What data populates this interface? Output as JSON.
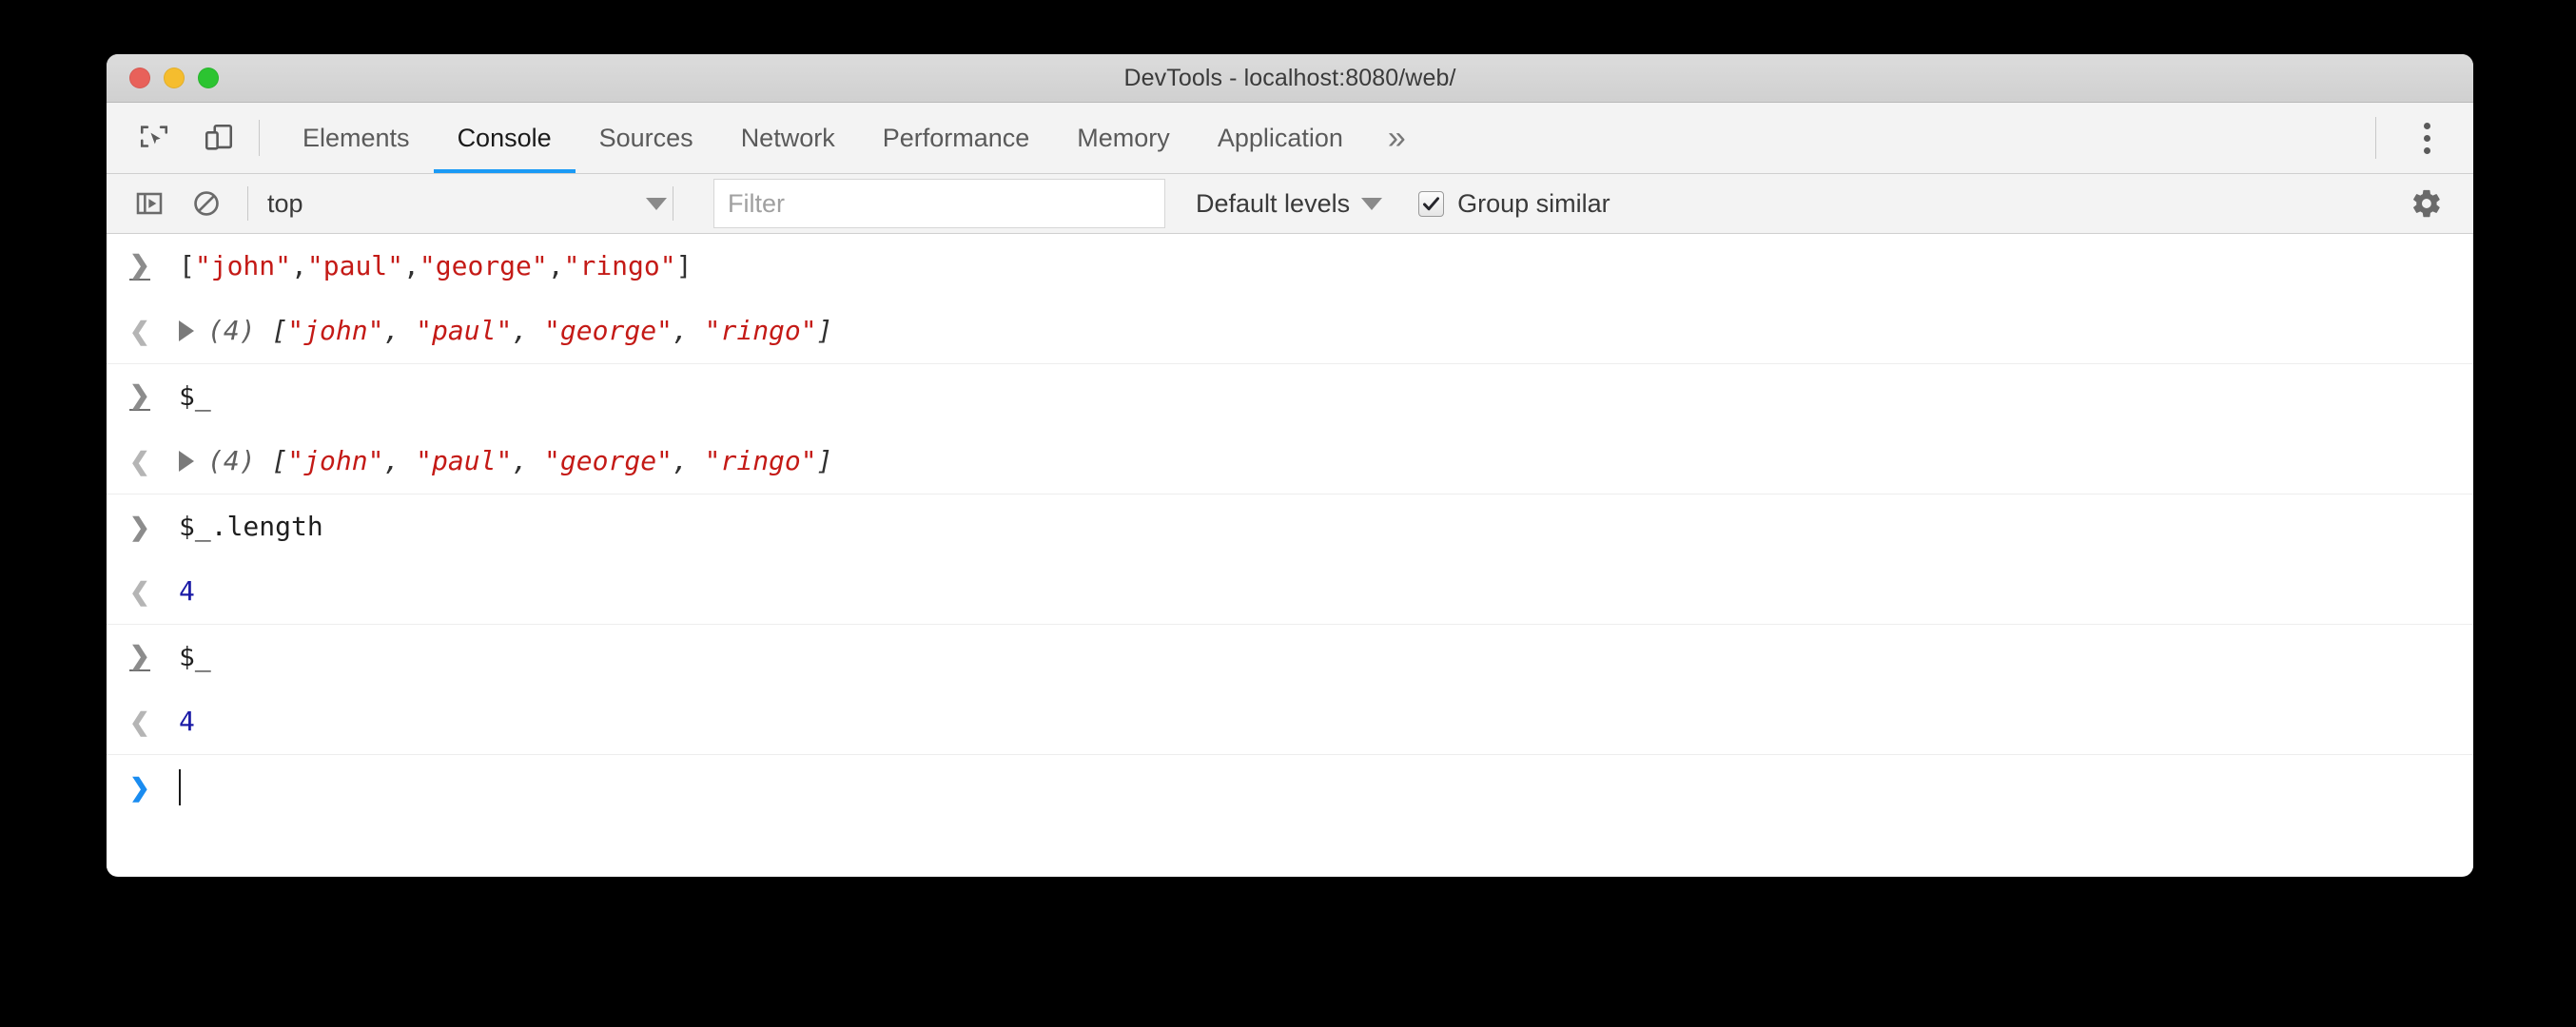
{
  "window": {
    "title": "DevTools - localhost:8080/web/",
    "traffic_lights": [
      {
        "name": "close",
        "color": "#e8615a"
      },
      {
        "name": "minimize",
        "color": "#f5bd2e"
      },
      {
        "name": "zoom",
        "color": "#2cc431"
      }
    ]
  },
  "toolbar": {
    "inspect_icon": "inspect-element-icon",
    "device_icon": "device-toolbar-icon",
    "overflow_label": "»",
    "tabs": [
      {
        "label": "Elements",
        "active": false
      },
      {
        "label": "Console",
        "active": true
      },
      {
        "label": "Sources",
        "active": false
      },
      {
        "label": "Network",
        "active": false
      },
      {
        "label": "Performance",
        "active": false
      },
      {
        "label": "Memory",
        "active": false
      },
      {
        "label": "Application",
        "active": false
      }
    ],
    "menu_icon": "kebab-menu-icon",
    "active_tab_underline_color": "#1a9af5"
  },
  "console_toolbar": {
    "sidebar_toggle_icon": "console-sidebar-toggle-icon",
    "clear_icon": "clear-console-icon",
    "context": "top",
    "context_caret": "▼",
    "filter_placeholder": "Filter",
    "filter_value": "",
    "levels_label": "Default levels",
    "levels_caret": "▼",
    "group_similar_label": "Group similar",
    "group_similar_checked": true,
    "checkmark": "✔",
    "settings_icon": "gear-icon"
  },
  "console": {
    "prompt_in": "❯",
    "prompt_out": "❮",
    "groups": [
      {
        "input": {
          "prompt_style": "underlined",
          "segments": [
            {
              "text": "[",
              "kind": "punct"
            },
            {
              "text": "\"john\"",
              "kind": "str"
            },
            {
              "text": ",",
              "kind": "punct"
            },
            {
              "text": "\"paul\"",
              "kind": "str"
            },
            {
              "text": ",",
              "kind": "punct"
            },
            {
              "text": "\"george\"",
              "kind": "str"
            },
            {
              "text": ",",
              "kind": "punct"
            },
            {
              "text": "\"ringo\"",
              "kind": "str"
            },
            {
              "text": "]",
              "kind": "punct"
            }
          ],
          "text": "[\"john\",\"paul\",\"george\",\"ringo\"]"
        },
        "output": {
          "expandable": true,
          "count": "(4)",
          "segments": [
            {
              "text": "[",
              "kind": "punct"
            },
            {
              "text": "\"john\"",
              "kind": "str"
            },
            {
              "text": ", ",
              "kind": "punct"
            },
            {
              "text": "\"paul\"",
              "kind": "str"
            },
            {
              "text": ", ",
              "kind": "punct"
            },
            {
              "text": "\"george\"",
              "kind": "str"
            },
            {
              "text": ", ",
              "kind": "punct"
            },
            {
              "text": "\"ringo\"",
              "kind": "str"
            },
            {
              "text": "]",
              "kind": "punct"
            }
          ],
          "text": "(4) [\"john\", \"paul\", \"george\", \"ringo\"]"
        }
      },
      {
        "input": {
          "prompt_style": "underlined",
          "segments": [
            {
              "text": "$_",
              "kind": "code"
            }
          ],
          "text": "$_"
        },
        "output": {
          "expandable": true,
          "count": "(4)",
          "segments": [
            {
              "text": "[",
              "kind": "punct"
            },
            {
              "text": "\"john\"",
              "kind": "str"
            },
            {
              "text": ", ",
              "kind": "punct"
            },
            {
              "text": "\"paul\"",
              "kind": "str"
            },
            {
              "text": ", ",
              "kind": "punct"
            },
            {
              "text": "\"george\"",
              "kind": "str"
            },
            {
              "text": ", ",
              "kind": "punct"
            },
            {
              "text": "\"ringo\"",
              "kind": "str"
            },
            {
              "text": "]",
              "kind": "punct"
            }
          ],
          "text": "(4) [\"john\", \"paul\", \"george\", \"ringo\"]"
        }
      },
      {
        "input": {
          "prompt_style": "plain",
          "segments": [
            {
              "text": "$_.length",
              "kind": "code"
            }
          ],
          "text": "$_.length"
        },
        "output": {
          "expandable": false,
          "count": "",
          "segments": [
            {
              "text": "4",
              "kind": "num"
            }
          ],
          "text": "4"
        }
      },
      {
        "input": {
          "prompt_style": "underlined",
          "segments": [
            {
              "text": "$_",
              "kind": "code"
            }
          ],
          "text": "$_"
        },
        "output": {
          "expandable": false,
          "count": "",
          "segments": [
            {
              "text": "4",
              "kind": "num"
            }
          ],
          "text": "4"
        }
      }
    ],
    "active_prompt": {
      "prompt": "❯",
      "value": "",
      "cursor": true
    }
  },
  "colors": {
    "accent": "#1a9af5",
    "string": "#c41a16",
    "number": "#1a1aa6",
    "prompt_active": "#1a8cf0"
  }
}
